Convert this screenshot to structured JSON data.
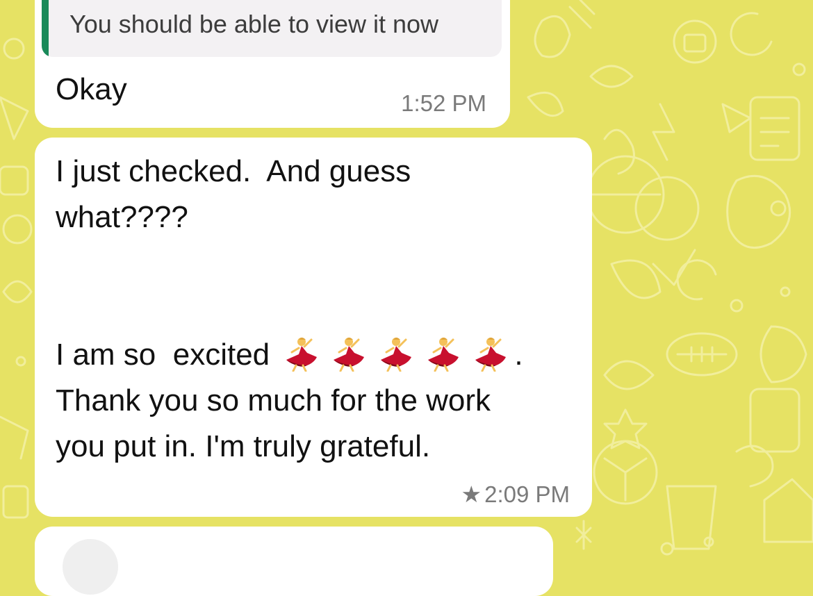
{
  "chat": {
    "colors": {
      "background": "#e6e264",
      "bubble": "#ffffff",
      "quote_bar": "#1a8a5a",
      "quote_bg": "#f3f1f3",
      "timestamp": "#7a7a7a"
    },
    "messages": [
      {
        "quoted_text": "You should be able to view it now",
        "text": "Okay",
        "time": "1:52 PM"
      },
      {
        "lines": [
          "I just checked.  And guess",
          "what????",
          "I am so  excited",
          "Thank you so much for the work",
          "you put in. I'm truly grateful."
        ],
        "emoji_name": "woman-dancing-emoji",
        "emoji_count": 5,
        "emoji_suffix": ".",
        "starred": true,
        "star_icon": "star-icon",
        "time": "2:09 PM"
      }
    ]
  }
}
